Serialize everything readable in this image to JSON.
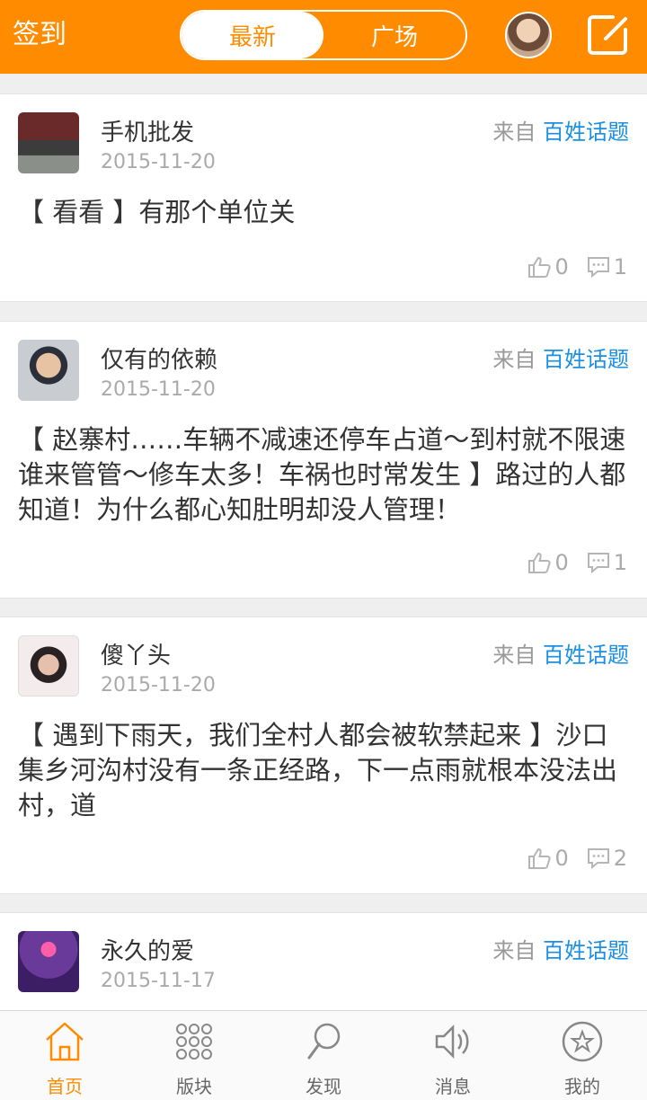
{
  "header": {
    "checkin_label": "签到",
    "tabs": [
      {
        "label": "最新",
        "active": true
      },
      {
        "label": "广场",
        "active": false
      }
    ],
    "compose_icon": "compose-icon",
    "accent_color": "#ff8c00"
  },
  "posts": [
    {
      "author": "手机批发",
      "date": "2015-11-20",
      "from_label": "来自",
      "board": "百姓话题",
      "text": "【 看看 】有那个单位关",
      "likes": "0",
      "comments": "1"
    },
    {
      "author": "仅有的依赖",
      "date": "2015-11-20",
      "from_label": "来自",
      "board": "百姓话题",
      "text": "【 赵寨村……车辆不减速还停车占道～到村就不限速谁来管管～修车太多！车祸也时常发生 】路过的人都知道！为什么都心知肚明却没人管理！",
      "likes": "0",
      "comments": "1"
    },
    {
      "author": "傻丫头",
      "date": "2015-11-20",
      "from_label": "来自",
      "board": "百姓话题",
      "text": "【 遇到下雨天，我们全村人都会被软禁起来 】沙口集乡河沟村没有一条正经路，下一点雨就根本没法出村，道",
      "likes": "0",
      "comments": "2"
    },
    {
      "author": "永久的爱",
      "date": "2015-11-17",
      "from_label": "来自",
      "board": "百姓话题"
    }
  ],
  "tabbar": [
    {
      "label": "首页",
      "icon": "home-icon",
      "active": true
    },
    {
      "label": "版块",
      "icon": "grid-icon",
      "active": false
    },
    {
      "label": "发现",
      "icon": "search-icon",
      "active": false
    },
    {
      "label": "消息",
      "icon": "speaker-icon",
      "active": false
    },
    {
      "label": "我的",
      "icon": "star-icon",
      "active": false
    }
  ]
}
